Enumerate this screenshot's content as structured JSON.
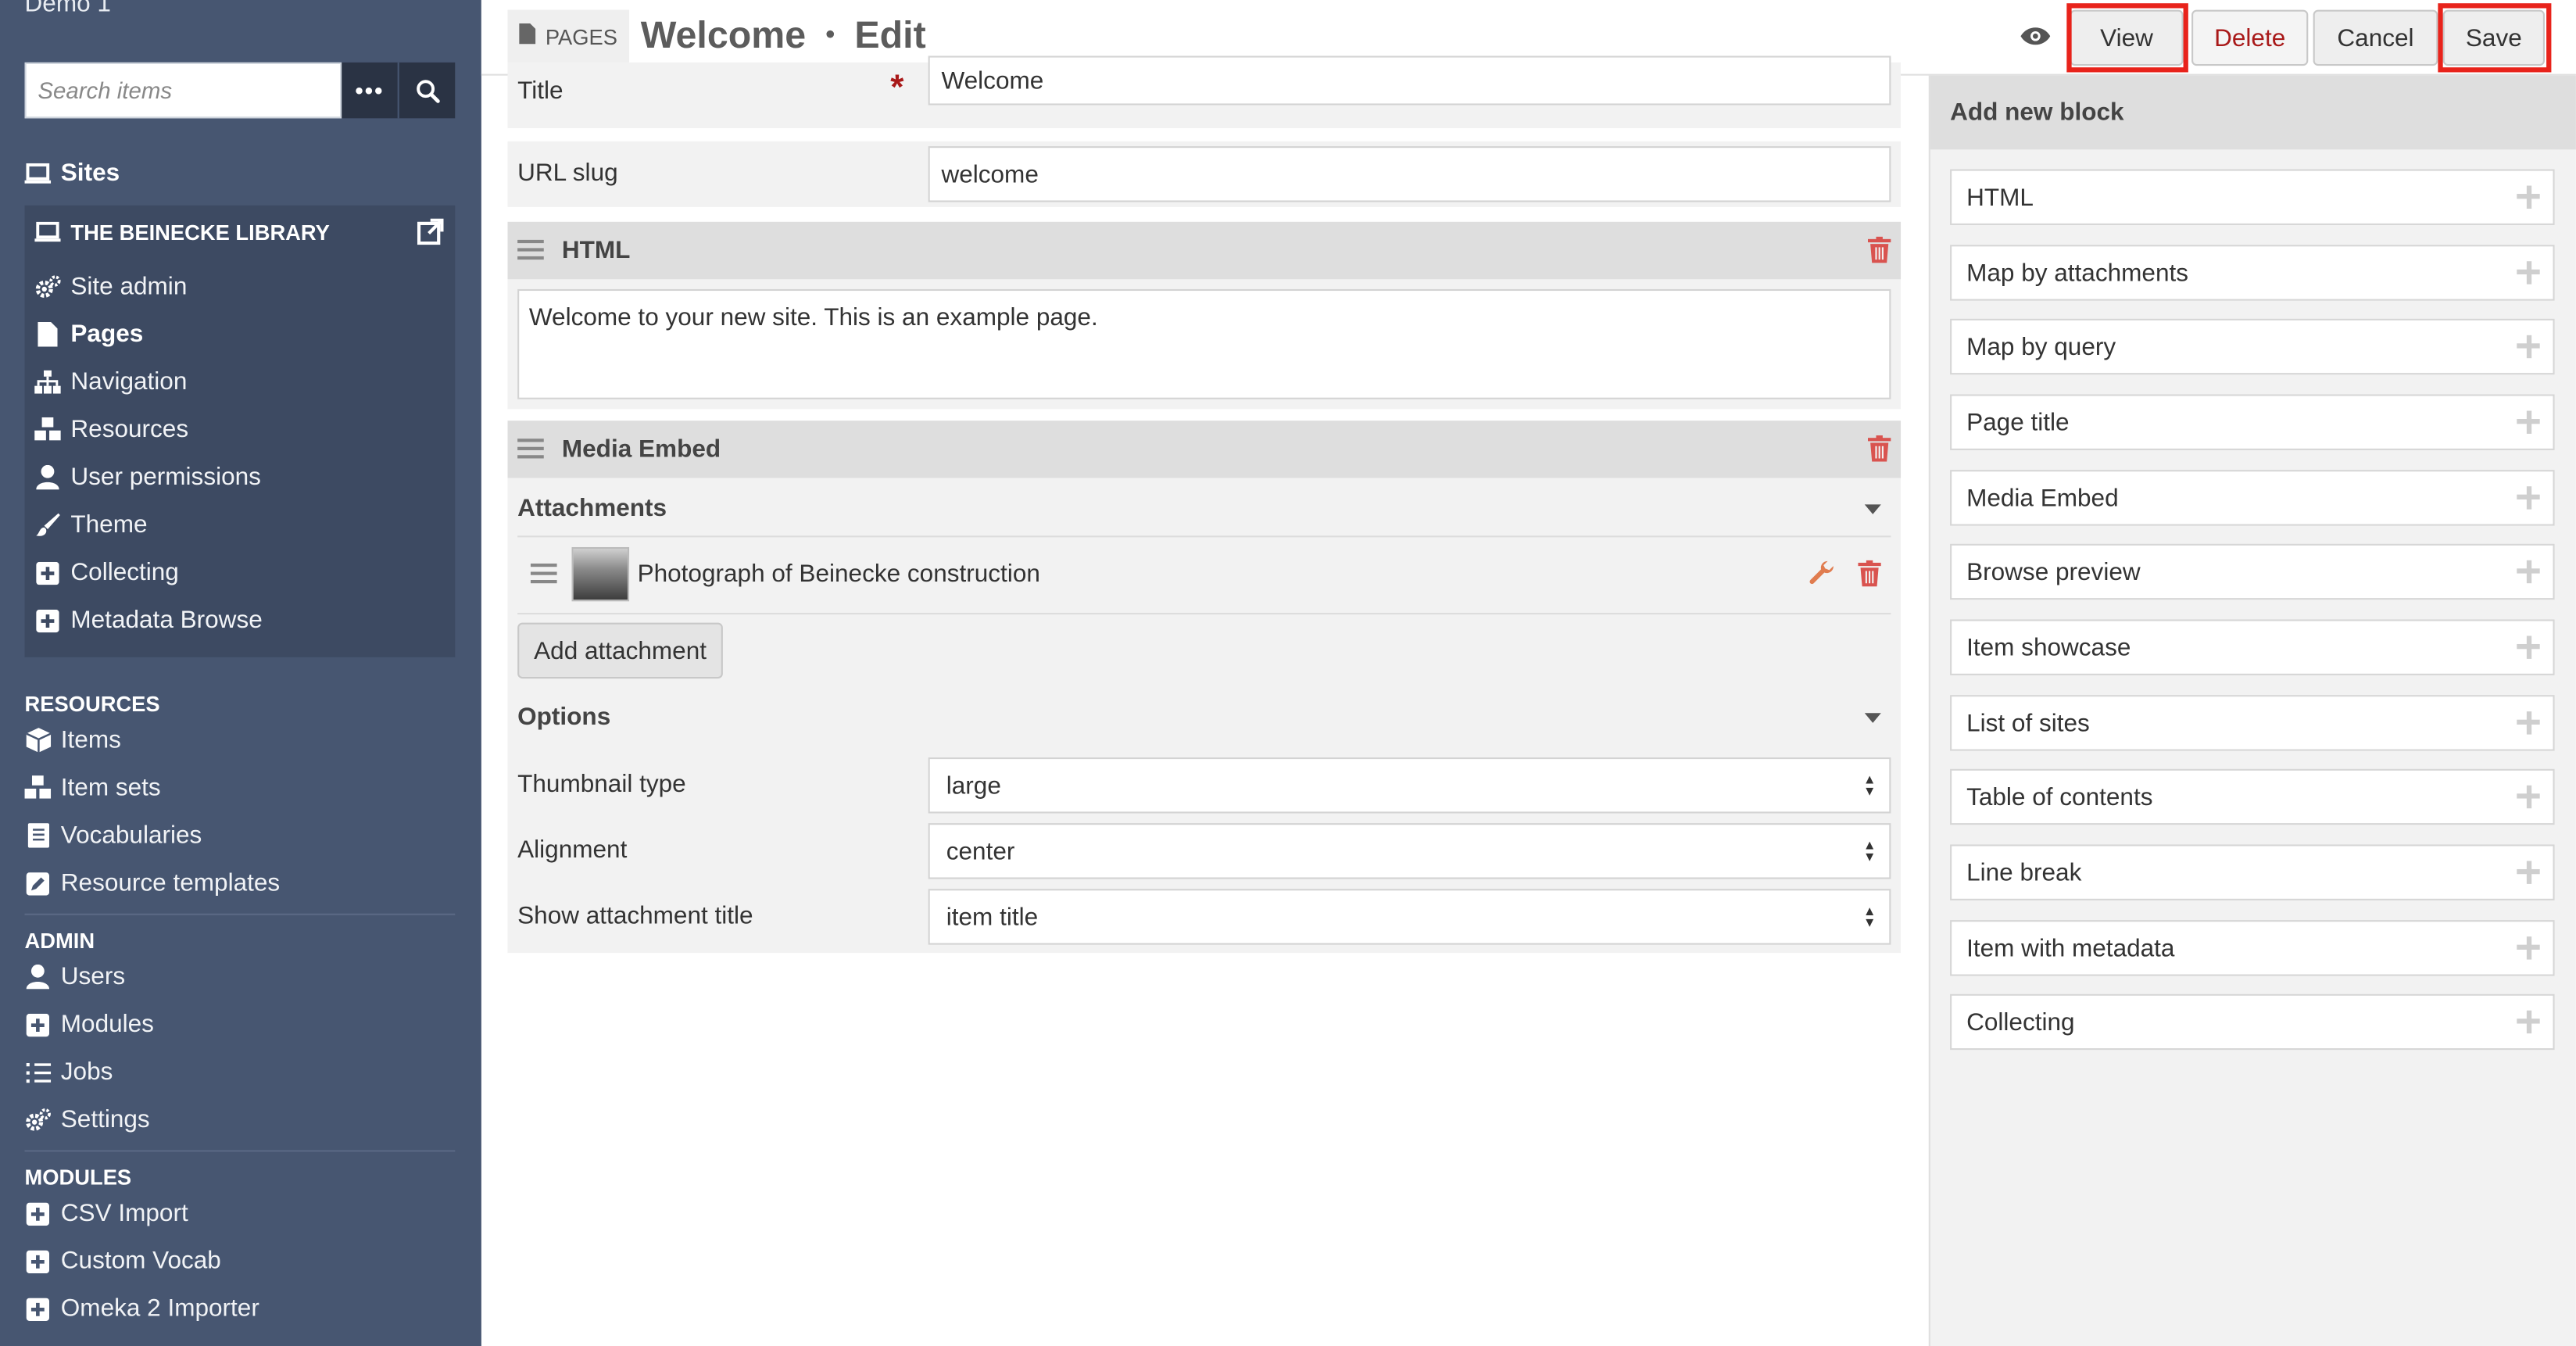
{
  "sidebar": {
    "install_name": "Demo 1",
    "search_placeholder": "Search items",
    "more_label": "•••",
    "sites_label": "Sites",
    "site": {
      "title": "THE BEINECKE LIBRARY",
      "items": [
        "Site admin",
        "Pages",
        "Navigation",
        "Resources",
        "User permissions",
        "Theme",
        "Collecting",
        "Metadata Browse"
      ]
    },
    "resources": {
      "heading": "RESOURCES",
      "items": [
        "Items",
        "Item sets",
        "Vocabularies",
        "Resource templates"
      ]
    },
    "admin": {
      "heading": "ADMIN",
      "items": [
        "Users",
        "Modules",
        "Jobs",
        "Settings"
      ]
    },
    "modules": {
      "heading": "MODULES",
      "items": [
        "CSV Import",
        "Custom Vocab",
        "Omeka 2 Importer"
      ]
    }
  },
  "header": {
    "section_badge": "PAGES",
    "title": "Welcome",
    "separator": "•",
    "action": "Edit",
    "buttons": {
      "view": "View",
      "delete": "Delete",
      "cancel": "Cancel",
      "save": "Save"
    },
    "highlight_color": "#e8231b"
  },
  "form": {
    "title_label": "Title",
    "required_mark": "*",
    "title_value": "Welcome",
    "slug_label": "URL slug",
    "slug_value": "welcome",
    "html_block": {
      "title": "HTML",
      "content": "Welcome to your new site. This is an example page."
    },
    "media_block": {
      "title": "Media Embed",
      "attachments_heading": "Attachments",
      "attachment_title": "Photograph of Beinecke construction",
      "add_attachment": "Add attachment",
      "options_heading": "Options",
      "options": [
        {
          "label": "Thumbnail type",
          "value": "large"
        },
        {
          "label": "Alignment",
          "value": "center"
        },
        {
          "label": "Show attachment title",
          "value": "item title"
        }
      ]
    }
  },
  "panel": {
    "title": "Add new block",
    "blocks": [
      "HTML",
      "Map by attachments",
      "Map by query",
      "Page title",
      "Media Embed",
      "Browse preview",
      "Item showcase",
      "List of sites",
      "Table of contents",
      "Line break",
      "Item with metadata",
      "Collecting"
    ]
  },
  "colors": {
    "sidebar": "#475671",
    "danger": "#a91919",
    "highlight": "#e8231b"
  }
}
